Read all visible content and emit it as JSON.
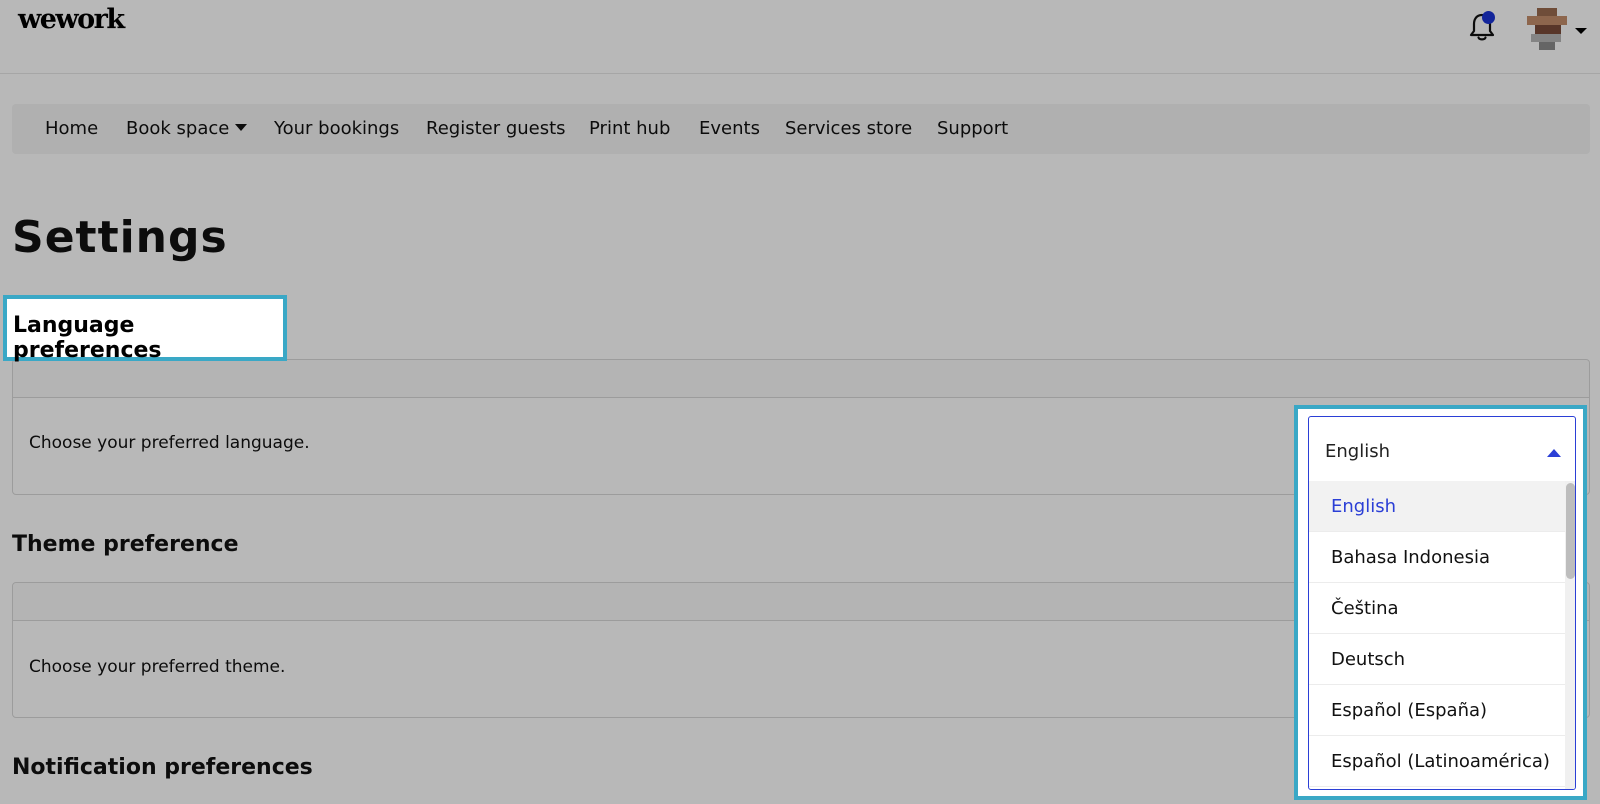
{
  "header": {
    "logo": "wework",
    "icons": {
      "notifications": "bell-icon",
      "profile": "avatar"
    },
    "colors": {
      "notification_dot": "#1b34d6"
    }
  },
  "nav": {
    "items": [
      {
        "label": "Home"
      },
      {
        "label": "Book space",
        "has_dropdown": true
      },
      {
        "label": "Your bookings"
      },
      {
        "label": "Register guests"
      },
      {
        "label": "Print hub"
      },
      {
        "label": "Events"
      },
      {
        "label": "Services store"
      },
      {
        "label": "Support"
      }
    ]
  },
  "page": {
    "title": "Settings"
  },
  "sections": {
    "language": {
      "title": "Language preferences",
      "description": "Choose your preferred language."
    },
    "theme": {
      "title": "Theme preference",
      "description": "Choose your preferred theme."
    },
    "notifications": {
      "title": "Notification preferences"
    }
  },
  "language_select": {
    "selected": "English",
    "options": [
      "English",
      "Bahasa Indonesia",
      "Čeština",
      "Deutsch",
      "Español (España)",
      "Español (Latinoamérica)"
    ],
    "accent_color": "#2b3fd6"
  },
  "highlight_color": "#3aa8c6"
}
